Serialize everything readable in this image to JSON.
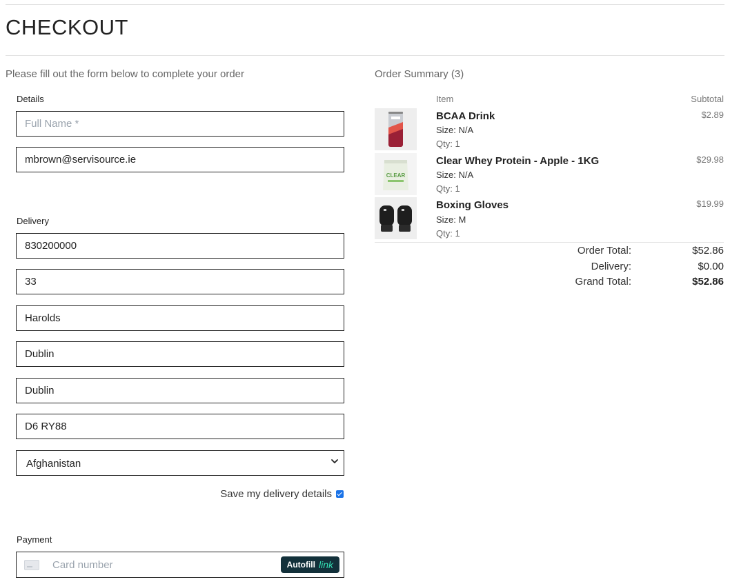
{
  "page_title": "CHECKOUT",
  "intro": "Please fill out the form below to complete your order",
  "details": {
    "label": "Details",
    "full_name_placeholder": "Full Name *",
    "full_name_value": "",
    "email_value": "mbrown@servisource.ie"
  },
  "delivery": {
    "label": "Delivery",
    "phone": "830200000",
    "street1": "33",
    "street2": "Harolds",
    "town": "Dublin",
    "county": "Dublin",
    "postcode": "D6 RY88",
    "country": "Afghanistan",
    "save_label": "Save my delivery details",
    "save_checked": true
  },
  "payment": {
    "label": "Payment",
    "card_placeholder": "Card number",
    "autofill_label": "Autofill",
    "link_label": "link"
  },
  "summary": {
    "title": "Order Summary (3)",
    "col_item": "Item",
    "col_subtotal": "Subtotal",
    "items": [
      {
        "name": "BCAA Drink",
        "size": "Size: N/A",
        "qty": "Qty: 1",
        "price": "$2.89"
      },
      {
        "name": "Clear Whey Protein - Apple - 1KG",
        "size": "Size: N/A",
        "qty": "Qty: 1",
        "price": "$29.98"
      },
      {
        "name": "Boxing Gloves",
        "size": "Size: M",
        "qty": "Qty: 1",
        "price": "$19.99"
      }
    ],
    "order_total_label": "Order Total:",
    "order_total": "$52.86",
    "delivery_label": "Delivery:",
    "delivery": "$0.00",
    "grand_total_label": "Grand Total:",
    "grand_total": "$52.86"
  },
  "colors": {
    "checkbox": "#1a73e8",
    "autofill_bg": "#12303a",
    "link_accent": "#33ddb3"
  }
}
